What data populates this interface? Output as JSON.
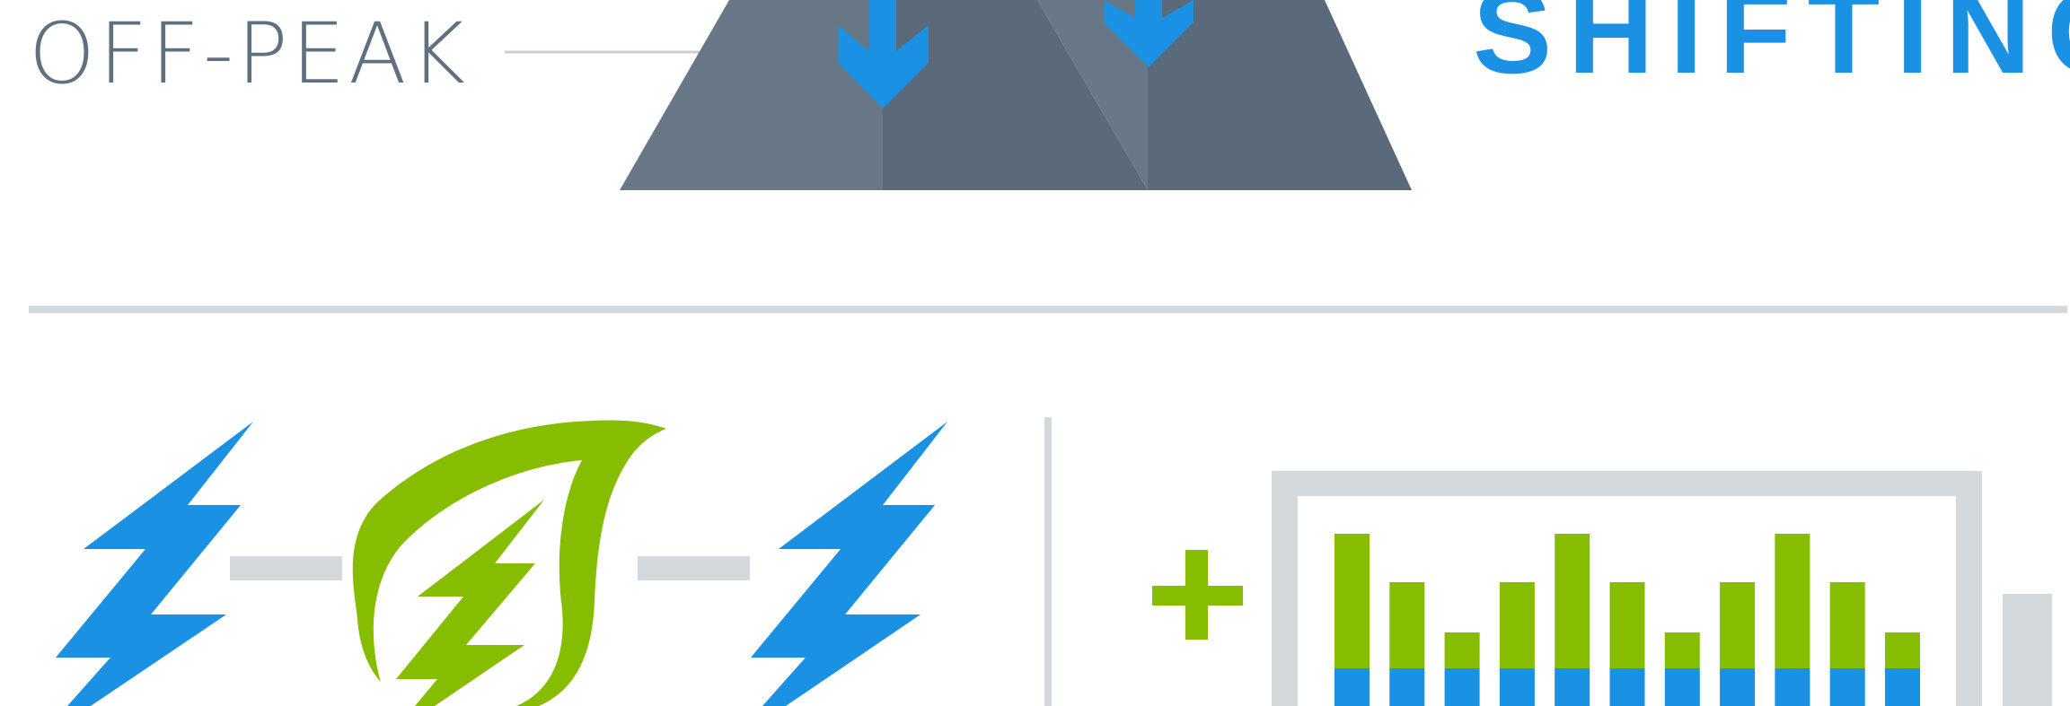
{
  "labels": {
    "off_peak": "OFF-PEAK",
    "shifting": "SHIFTING"
  },
  "colors": {
    "blue": "#1a91e3",
    "green": "#86bd00",
    "slate_light": "#687887",
    "slate_dark": "#5a6a7b",
    "gray_line": "#d4d9dd",
    "text_gray": "#5f7080"
  },
  "icons": {
    "left_bolt": "lightning-bolt-icon",
    "center": "leaf-lightning-icon",
    "right_bolt": "lightning-bolt-icon",
    "plus": "plus-icon",
    "down_arrows": "down-arrow-icon"
  },
  "bar_panel": {
    "green_levels": [
      3,
      2,
      1,
      2,
      3,
      2,
      1,
      2,
      3,
      2,
      1
    ],
    "blue_base": [
      1,
      1,
      1,
      1,
      1,
      1,
      1,
      1,
      1,
      1,
      1
    ]
  }
}
